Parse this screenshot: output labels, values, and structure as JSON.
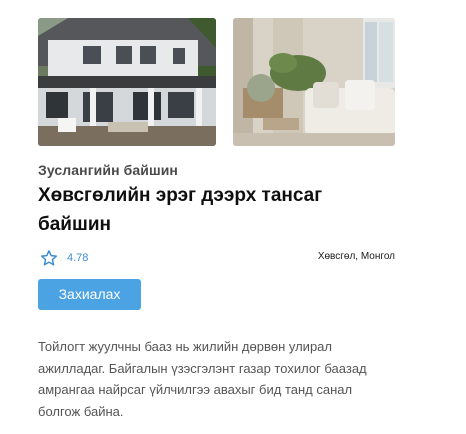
{
  "listing": {
    "photos": [
      {
        "alt": "cabin-exterior"
      },
      {
        "alt": "living-room-interior"
      }
    ],
    "category": "Зуслангийн байшин",
    "title": "Хөвсгөлийн эрэг дээрх тансаг байшин",
    "rating": {
      "icon": "star-outline-icon",
      "value": "4.78"
    },
    "location": "Хөвсгөл, Монгол",
    "book_button": "Захиалах",
    "description": "Тойлогт жуулчны бааз нь жилийн дөрвөн улирал ажилладаг. Байгалын үзэсгэлэнт газар тохилог баазад амрангаа найрсаг үйлчилгээ авахыг бид танд санал болгож байна."
  },
  "colors": {
    "accent": "#4ba3e3",
    "star": "#3d8fd1",
    "text_muted": "#555555"
  }
}
